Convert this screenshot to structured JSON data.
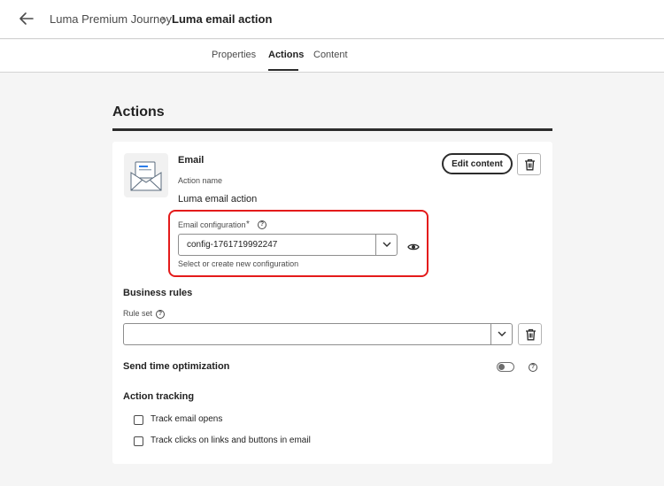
{
  "header": {
    "back_icon": "arrow-left-icon",
    "breadcrumb_parent": "Luma Premium Journey",
    "breadcrumb_current": "Luma email action"
  },
  "tabs": [
    {
      "label": "Properties",
      "active": false
    },
    {
      "label": "Actions",
      "active": true
    },
    {
      "label": "Content",
      "active": false
    }
  ],
  "section": {
    "title": "Actions"
  },
  "email_action": {
    "channel_label": "Email",
    "channel_icon": "envelope-icon",
    "action_name_label": "Action name",
    "action_name_value": "Luma email action",
    "edit_content_label": "Edit content",
    "email_configuration": {
      "label": "Email configuration",
      "required_marker": "*",
      "value": "config-1761719992247",
      "helper_text": "Select or create new configuration",
      "preview_icon": "eye-icon",
      "highlight_color": "#e41b1b"
    }
  },
  "business_rules": {
    "heading": "Business rules",
    "rule_set_label": "Rule set",
    "rule_set_value": ""
  },
  "send_time_optimization": {
    "label": "Send time optimization",
    "enabled": false
  },
  "action_tracking": {
    "heading": "Action tracking",
    "options": [
      {
        "label": "Track email opens",
        "checked": false
      },
      {
        "label": "Track clicks on links and buttons in email",
        "checked": false
      }
    ]
  }
}
